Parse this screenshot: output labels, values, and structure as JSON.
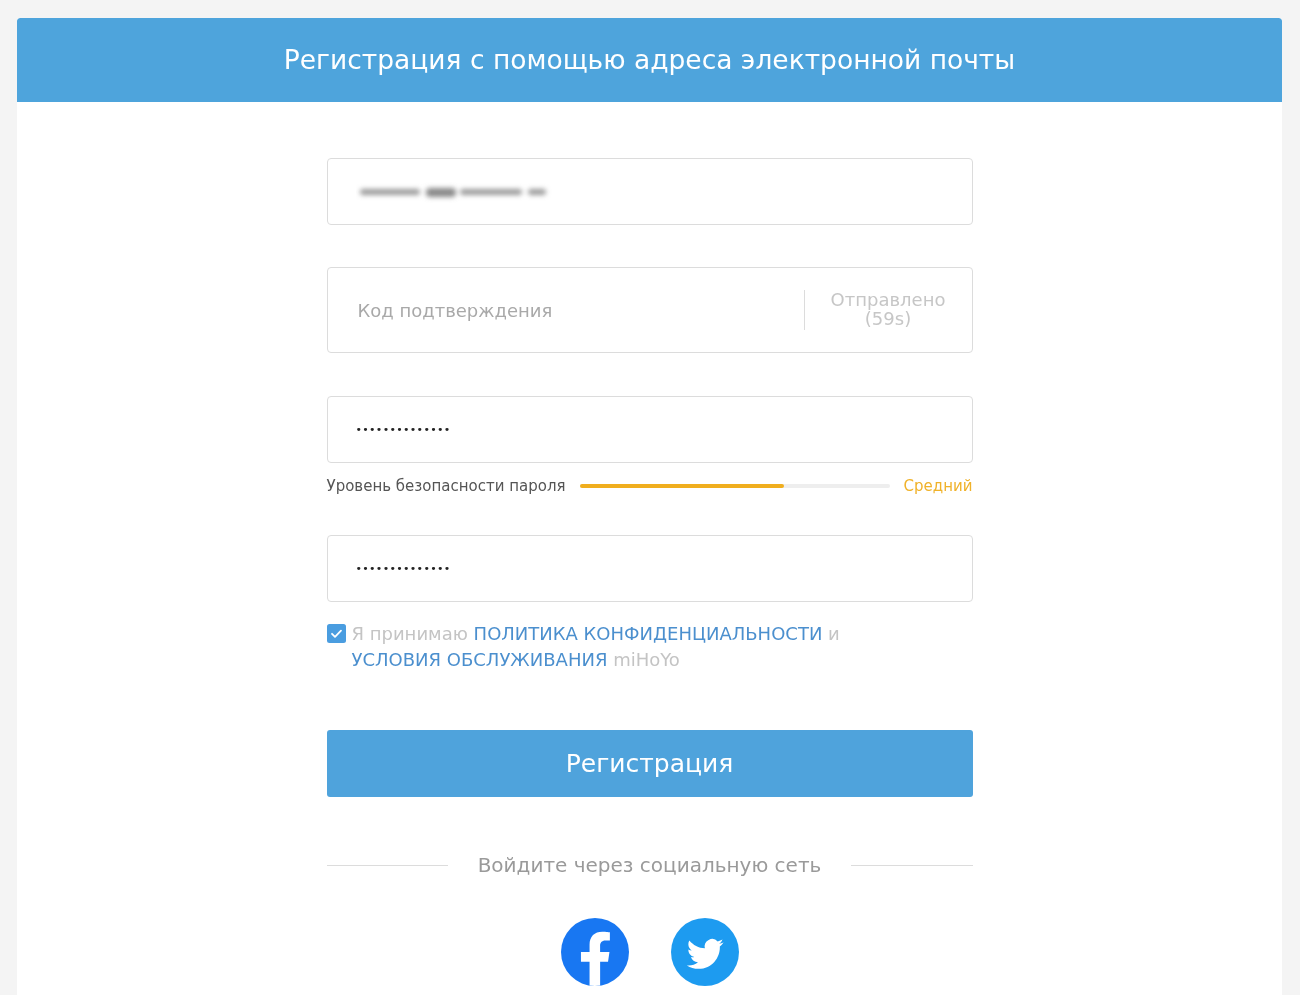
{
  "header": {
    "title": "Регистрация с помощью адреса электронной почты"
  },
  "fields": [
    {
      "kind": "email",
      "blurred": true
    },
    {
      "kind": "code",
      "placeholder": "Код подтверждения",
      "action": {
        "label": "Отправлено (59s)",
        "disabled": true
      }
    },
    {
      "kind": "password",
      "value": "••••••••••••••",
      "strength": {
        "label": "Уровень безопасности пароля",
        "level": 0.66,
        "reading": "Средний"
      }
    },
    {
      "kind": "password",
      "value": "••••••••••••••"
    }
  ],
  "agreement": {
    "checked": true,
    "parts": [
      {
        "kind": "text",
        "text": "Я принимаю"
      },
      {
        "kind": "link",
        "text": "ПОЛИТИКА КОНФИДЕНЦИАЛЬНОСТИ"
      },
      {
        "kind": "text",
        "text": "и"
      },
      {
        "kind": "link",
        "text": "УСЛОВИЯ ОБСЛУЖИВАНИЯ"
      },
      {
        "kind": "text",
        "text": "miHoYo"
      }
    ]
  },
  "submit": {
    "label": "Регистрация"
  },
  "social": {
    "label": "Войдите через социальную сеть",
    "buttons": [
      {
        "kind": "facebook"
      },
      {
        "kind": "twitter"
      }
    ]
  }
}
